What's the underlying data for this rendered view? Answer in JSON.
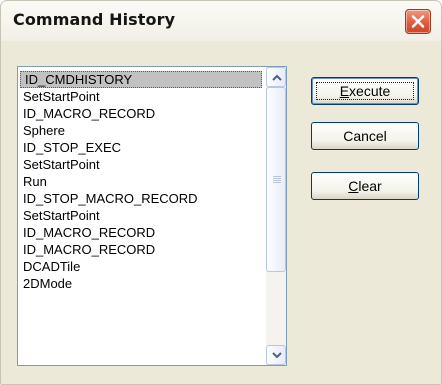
{
  "window": {
    "title": "Command History"
  },
  "list": {
    "items": [
      "ID_CMDHISTORY",
      "SetStartPoint",
      "ID_MACRO_RECORD",
      "Sphere",
      "ID_STOP_EXEC",
      "SetStartPoint",
      "Run",
      "ID_STOP_MACRO_RECORD",
      "SetStartPoint",
      "ID_MACRO_RECORD",
      "ID_MACRO_RECORD",
      "DCADTile",
      "2DMode"
    ],
    "selected_index": 0
  },
  "buttons": {
    "execute": {
      "mnemonic": "E",
      "rest": "xecute"
    },
    "cancel": {
      "label": "Cancel"
    },
    "clear": {
      "mnemonic": "C",
      "rest": "lear"
    }
  },
  "icons": {
    "close": "close-icon",
    "scroll_up": "chevron-up-icon",
    "scroll_down": "chevron-down-icon",
    "scroll_grip": "grip-icon"
  },
  "colors": {
    "dialog_bg": "#ece9d8",
    "close_button": "#df5b3e",
    "list_border": "#7f9db9",
    "selection_bg": "#c1c1c1",
    "button_border": "#003c74"
  }
}
